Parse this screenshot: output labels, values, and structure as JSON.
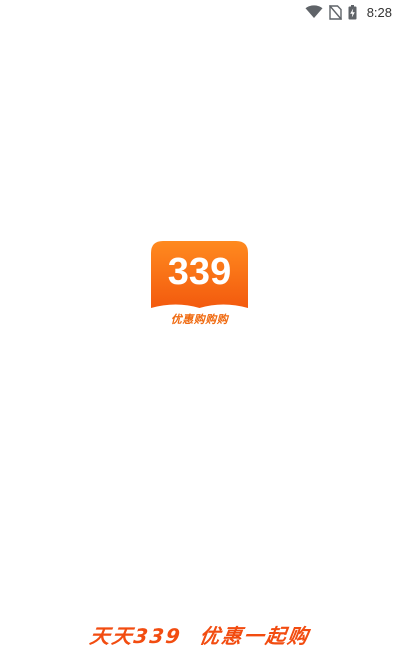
{
  "status_bar": {
    "time": "8:28",
    "icons": [
      "wifi-icon",
      "no-sim-icon",
      "battery-charging-icon"
    ]
  },
  "splash": {
    "logo_number": "339",
    "logo_tagline": "优惠购购购",
    "colors": {
      "logo_top": "#ff8a1f",
      "logo_bottom": "#f35a0e",
      "tagline": "#f06a10",
      "slogan": "#f24c10"
    }
  },
  "slogan": {
    "part1": "天天339",
    "part2": "优惠一起购"
  }
}
